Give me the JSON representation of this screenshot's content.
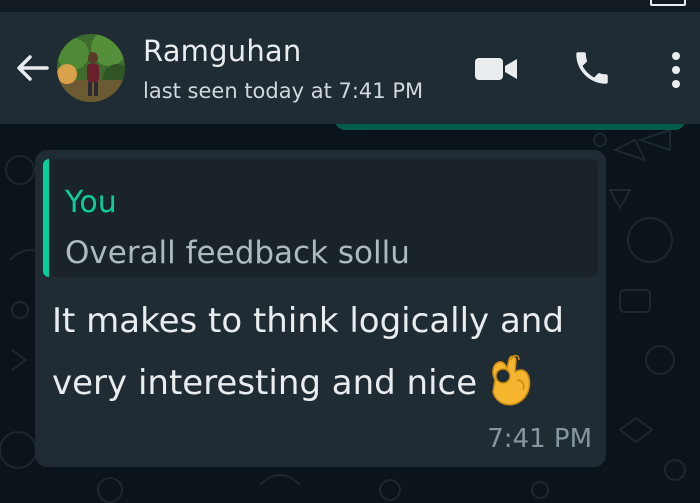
{
  "status_bar": {
    "time_partial": "···· ···· ···"
  },
  "header": {
    "contact_name": "Ramguhan",
    "last_seen": "last seen today at 7:41 PM"
  },
  "icons": {
    "back": "back-arrow-icon",
    "video": "video-call-icon",
    "call": "voice-call-icon",
    "menu": "more-options-icon",
    "emoji": "ok-hand-emoji"
  },
  "message": {
    "quoted_author": "You",
    "quoted_text": "Overall feedback sollu",
    "line1": "It makes to think logically and",
    "line2": "very interesting and nice",
    "time": "7:41 PM"
  },
  "colors": {
    "header_bg": "#1f2c34",
    "chat_bg": "#0b141a",
    "bubble_bg": "#202c33",
    "quote_accent": "#06cf9c",
    "outgoing_bubble": "#005c4b"
  }
}
